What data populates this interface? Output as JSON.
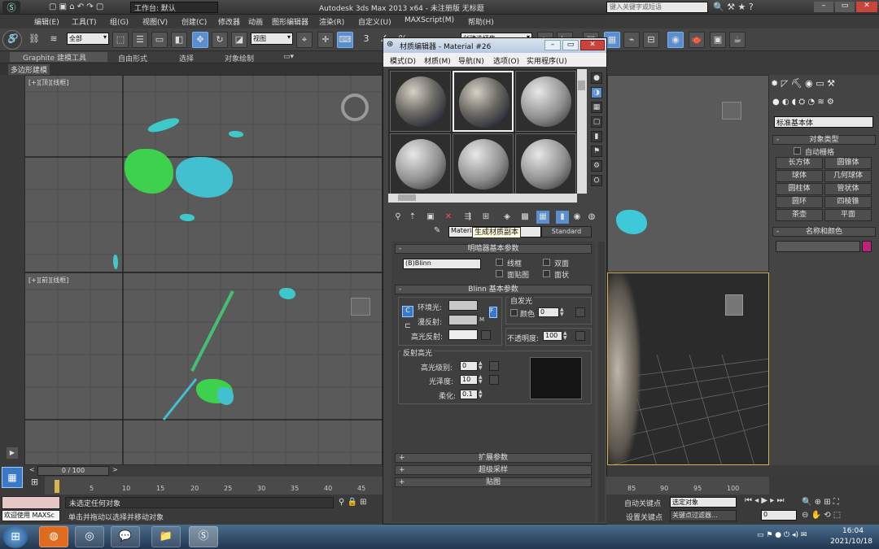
{
  "app": {
    "title": "Autodesk 3ds Max  2013 x64    - 未注册版    无标题",
    "workspace_label": "工作台: 默认",
    "search_placeholder": "键入关键字或短语"
  },
  "menu": [
    "编辑(E)",
    "工具(T)",
    "组(G)",
    "视图(V)",
    "创建(C)",
    "修改器",
    "动画",
    "图形编辑器",
    "渲染(R)",
    "自定义(U)",
    "MAXScript(M)",
    "帮助(H)"
  ],
  "toolbar": {
    "selection_filter": "全部",
    "ref_coord": "视图",
    "named_selection": "创建选择集",
    "snap_label": "3"
  },
  "ribbon": {
    "tabs": [
      "Graphite 建模工具",
      "自由形式",
      "选择",
      "对象绘制"
    ],
    "sub": "多边形建模"
  },
  "viewports": {
    "top_label": "[+][顶][线框]",
    "front_label": "[+][前][线框]"
  },
  "material_editor": {
    "title": "材质编辑器 - Material #26",
    "menu": [
      "模式(D)",
      "材质(M)",
      "导航(N)",
      "选项(O)",
      "实用程序(U)"
    ],
    "material_name": "Material #26",
    "material_type": "Standard",
    "tooltip": "生成材质副本",
    "shader_rollout": "明暗器基本参数",
    "shader": "(B)Blinn",
    "shader_options": [
      "线框",
      "双面",
      "面贴图",
      "面状"
    ],
    "blinn_rollout": "Blinn 基本参数",
    "self_illum": "自发光",
    "color_label": "颜色",
    "color_value": "0",
    "ambient": "环境光:",
    "diffuse": "漫反射:",
    "specular": "高光反射:",
    "opacity_label": "不透明度:",
    "opacity_value": "100",
    "spec_section": "反射高光",
    "spec_level_label": "高光级别:",
    "spec_level": "0",
    "glossiness_label": "光泽度:",
    "glossiness": "10",
    "soften_label": "柔化:",
    "soften": "0.1",
    "rollouts_collapsed": [
      "扩展参数",
      "超级采样",
      "贴图"
    ]
  },
  "command_panel": {
    "dropdown": "标准基本体",
    "object_type_title": "对象类型",
    "autogrid": "自动栅格",
    "buttons": [
      "长方体",
      "圆锥体",
      "球体",
      "几何球体",
      "圆柱体",
      "管状体",
      "圆环",
      "四棱锥",
      "茶壶",
      "平面"
    ],
    "name_color_title": "名称和颜色",
    "object_color": "#c0217a"
  },
  "timeline": {
    "frame": "0 / 100",
    "ticks_left": [
      "5",
      "10",
      "15",
      "20",
      "25",
      "30",
      "35",
      "40",
      "45"
    ],
    "ticks_right": [
      "85",
      "90",
      "95",
      "100"
    ]
  },
  "status": {
    "maxscript_label": "欢迎使用 MAXSc",
    "selection_status": "未选定任何对象",
    "prompt": "单击并拖动以选择并移动对象",
    "auto_key": "自动关键点",
    "selected_object": "选定对象",
    "set_key": "设置关键点",
    "key_filters": "关键点过滤器...",
    "frame_value": "0"
  },
  "taskbar": {
    "time": "16:04",
    "date": "2021/10/18"
  }
}
